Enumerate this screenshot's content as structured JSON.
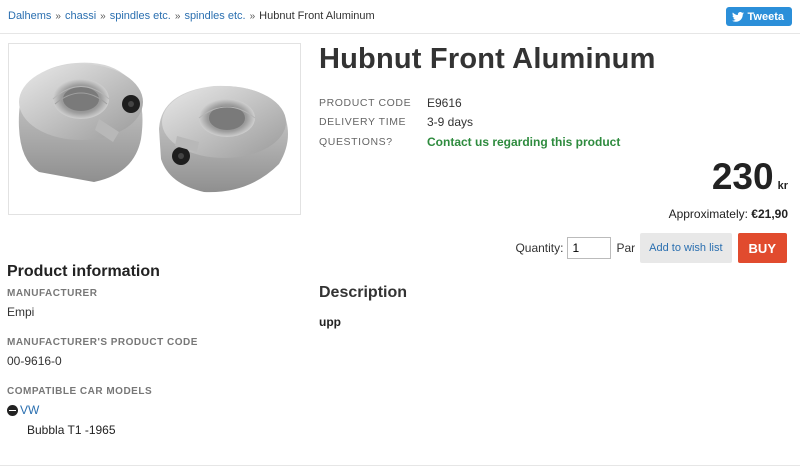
{
  "breadcrumb": {
    "items": [
      "Dalhems",
      "chassi",
      "spindles etc.",
      "spindles etc."
    ],
    "current": "Hubnut Front Aluminum"
  },
  "share": {
    "tweet_label": "Tweeta",
    "icon": "twitter-bird-icon"
  },
  "product": {
    "title": "Hubnut Front Aluminum",
    "code_label": "PRODUCT CODE",
    "code": "E9616",
    "delivery_label": "DELIVERY TIME",
    "delivery": "3-9 days",
    "questions_label": "QUESTIONS?",
    "contact": "Contact us regarding this product"
  },
  "price": {
    "amount": "230",
    "currency": "kr",
    "approx_label": "Approximately:",
    "approx_value": "€21,90"
  },
  "purchase": {
    "quantity_label": "Quantity:",
    "quantity_value": "1",
    "unit": "Par",
    "wish_label": "Add to wish list",
    "buy_label": "BUY"
  },
  "info": {
    "heading": "Product information",
    "manufacturer_label": "MANUFACTURER",
    "manufacturer": "Empi",
    "mpc_label": "MANUFACTURER'S PRODUCT CODE",
    "mpc": "00-9616-0",
    "models_label": "COMPATIBLE CAR MODELS",
    "model_make": "VW",
    "model_name": "Bubbla T1 -1965"
  },
  "description": {
    "heading": "Description",
    "text": "upp"
  },
  "colors": {
    "link": "#2a6fb0",
    "contact": "#2e8b3e",
    "buy": "#e14b2e",
    "tweet": "#2b8fd9"
  }
}
